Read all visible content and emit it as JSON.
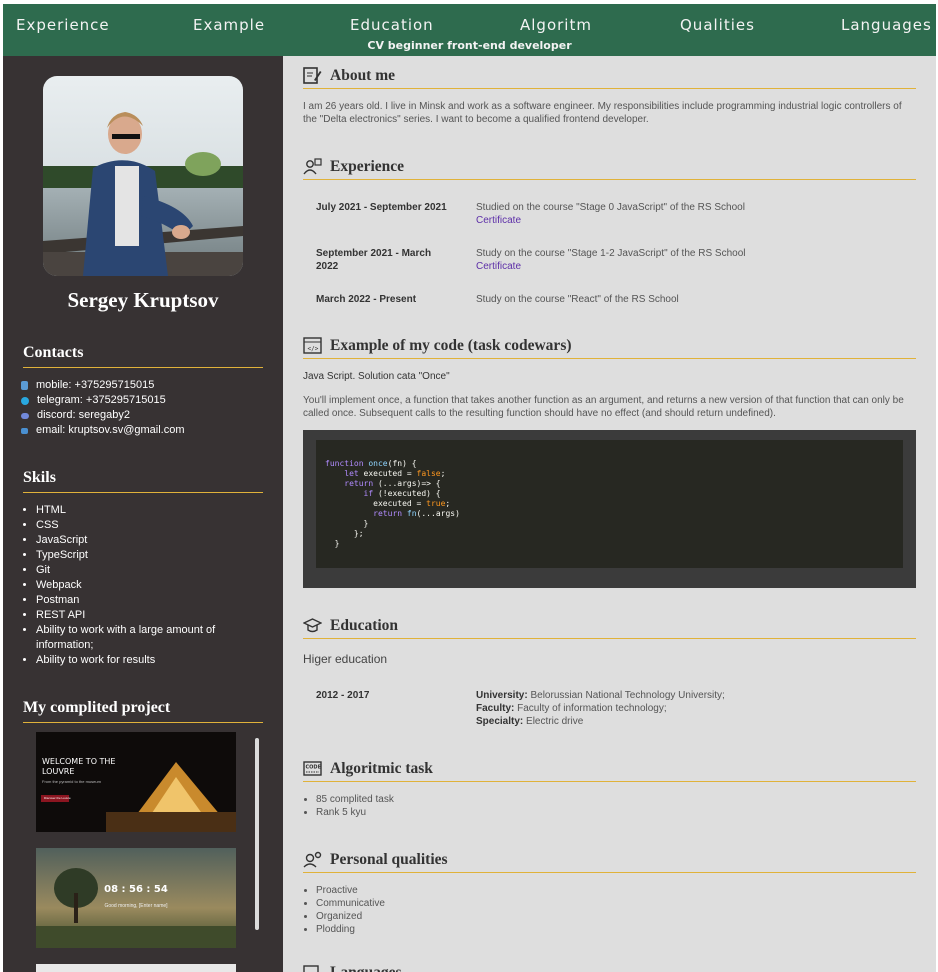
{
  "nav": {
    "items": [
      "Experience",
      "Example",
      "Education",
      "Algoritm",
      "Qualities",
      "Languages"
    ],
    "subtitle": "CV beginner front-end developer"
  },
  "sidebar": {
    "name": "Sergey Kruptsov",
    "contacts_title": "Contacts",
    "contacts": [
      {
        "icon": "phone-icon",
        "text": "mobile: +375295715015"
      },
      {
        "icon": "telegram-icon",
        "text": "telegram: +375295715015"
      },
      {
        "icon": "discord-icon",
        "text": "discord: seregaby2"
      },
      {
        "icon": "email-icon",
        "text": "email: kruptsov.sv@gmail.com"
      }
    ],
    "skills_title": "Skils",
    "skills": [
      "HTML",
      "CSS",
      "JavaScript",
      "TypeScript",
      "Git",
      "Webpack",
      "Postman",
      "REST API",
      "Ability to work with a large amount of information;",
      "Ability to work for results"
    ],
    "projects_title": "My complited project",
    "projects": [
      {
        "headline": "WELCOME TO THE LOUVRE",
        "sub": "From the pyramid to the museum",
        "button": "Discover the Louvre"
      },
      {
        "time": "08 : 56 : 54",
        "greeting": "Good morning, [Enter name]"
      }
    ]
  },
  "about": {
    "title": "About me",
    "text": "I am 26 years old. I live in Minsk and work as a software engineer. My responsibilities include programming industrial logic controllers of the \"Delta electronics\" series. I want to become a qualified frontend developer."
  },
  "experience": {
    "title": "Experience",
    "rows": [
      {
        "date": "July 2021 - September 2021",
        "desc": "Studied on the course \"Stage 0 JavaScript\" of the RS School",
        "link": "Certificate"
      },
      {
        "date": "September 2021 - March 2022",
        "desc": "Study on the course \"Stage 1-2 JavaScript\" of the RS School",
        "link": "Certificate"
      },
      {
        "date": "March 2022 - Present",
        "desc": "Study on the course \"React\" of the RS School",
        "link": ""
      }
    ]
  },
  "example": {
    "title": "Example of my code (task codewars)",
    "subtitle": "Java Script. Solution cata \"Once\"",
    "text": "You'll implement once, a function that takes another function as an argument, and returns a new version of that function that can only be called once. Subsequent calls to the resulting function should have no effect (and should return undefined)."
  },
  "education": {
    "title": "Education",
    "level": "Higer education",
    "date": "2012 - 2017",
    "university_label": "University:",
    "university": "Belorussian National Technology University;",
    "faculty_label": "Faculty:",
    "faculty": "Faculty of information technology;",
    "specialty_label": "Specialty:",
    "specialty": "Electric drive"
  },
  "algoritmic": {
    "title": "Algoritmic task",
    "items": [
      "85 complited task",
      "Rank 5 kyu"
    ]
  },
  "qualities": {
    "title": "Personal qualities",
    "items": [
      "Proactive",
      "Communicative",
      "Organized",
      "Plodding"
    ]
  },
  "languages": {
    "title": "Languages"
  },
  "colors": {
    "header_bg": "#2e6b4e",
    "sidebar_bg": "#373233",
    "main_bg": "#dedede",
    "accent_line": "#e0b23a",
    "link": "#5d2fa8"
  }
}
